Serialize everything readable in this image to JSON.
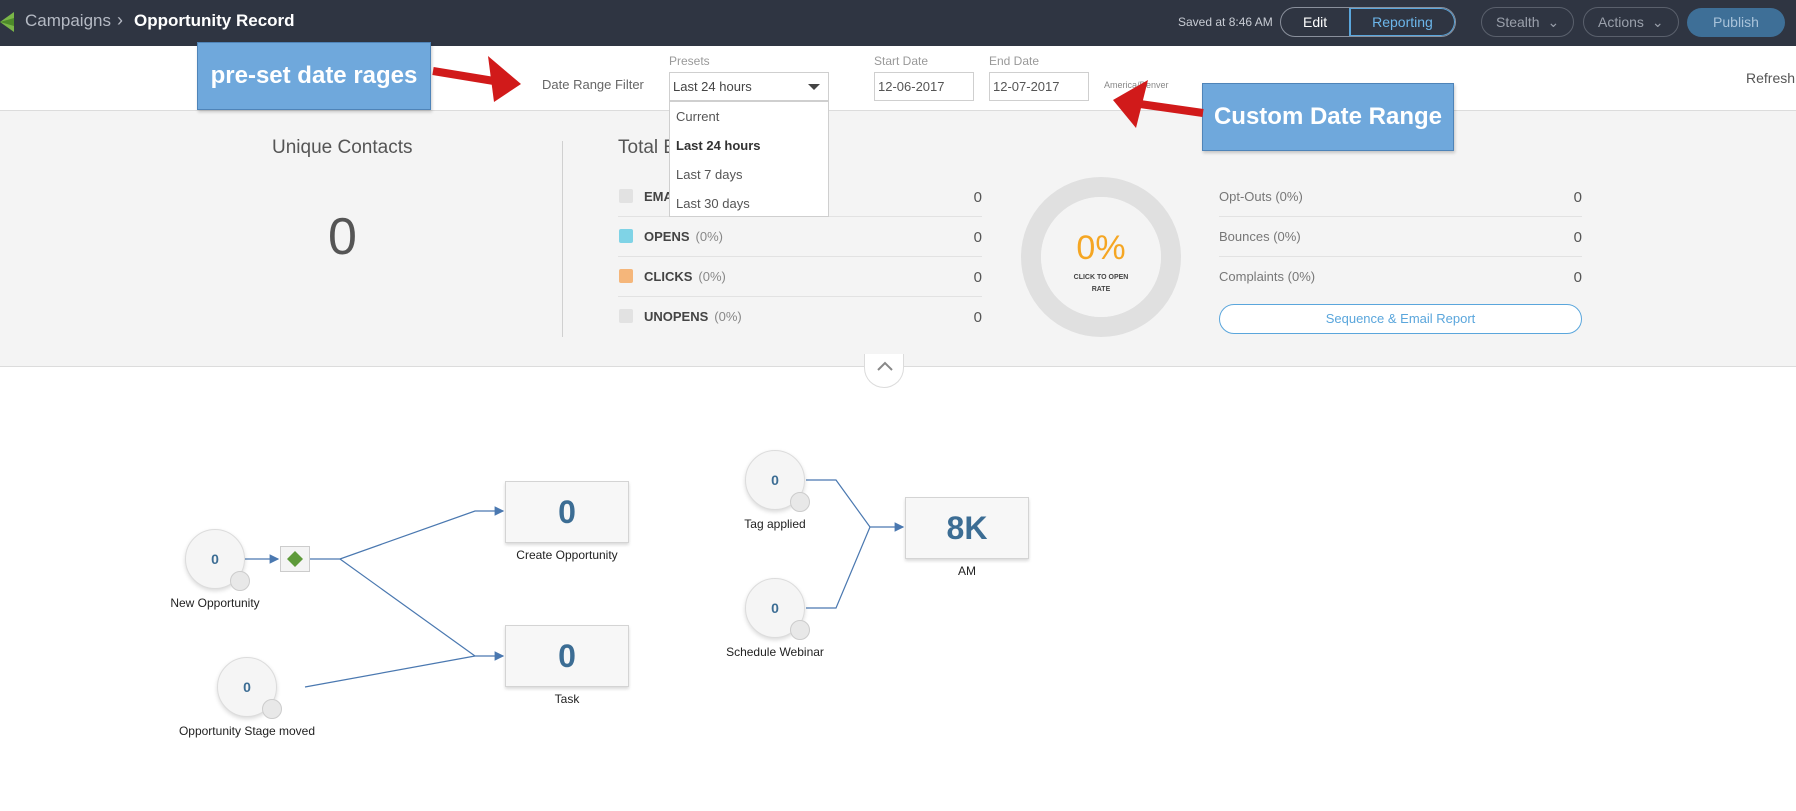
{
  "header": {
    "breadcrumb_root": "Campaigns",
    "breadcrumb_sep": "›",
    "title": "Opportunity Record",
    "saved_text": "Saved at 8:46 AM",
    "edit_label": "Edit",
    "reporting_label": "Reporting",
    "stealth_label": "Stealth",
    "actions_label": "Actions",
    "publish_label": "Publish"
  },
  "filter": {
    "label": "Date Range Filter",
    "presets_label": "Presets",
    "preset_value": "Last 24 hours",
    "start_label": "Start Date",
    "start_value": "12-06-2017",
    "end_label": "End Date",
    "end_value": "12-07-2017",
    "timezone": "America/Denver",
    "refresh_label": "Refresh",
    "options": [
      "Current",
      "Last 24 hours",
      "Last 7 days",
      "Last 30 days"
    ],
    "selected_option": "Last 24 hours"
  },
  "stats": {
    "unique_contacts_title": "Unique Contacts",
    "unique_contacts_value": "0",
    "total_title": "Total E",
    "metrics": [
      {
        "name": "EMA",
        "pct": "",
        "value": "0",
        "color": "#e2e2e2"
      },
      {
        "name": "OPENS",
        "pct": "(0%)",
        "value": "0",
        "color": "#7fd3e6"
      },
      {
        "name": "CLICKS",
        "pct": "(0%)",
        "value": "0",
        "color": "#f5b67a"
      },
      {
        "name": "UNOPENS",
        "pct": "(0%)",
        "value": "0",
        "color": "#e2e2e2"
      }
    ],
    "ring_value": "0%",
    "ring_caption": "CLICK TO OPEN RATE",
    "right_metrics": [
      {
        "name": "Opt-Outs (0%)",
        "value": "0"
      },
      {
        "name": "Bounces (0%)",
        "value": "0"
      },
      {
        "name": "Complaints (0%)",
        "value": "0"
      }
    ],
    "report_button": "Sequence & Email Report"
  },
  "flow": {
    "new_opportunity": {
      "count": "0",
      "label": "New Opportunity"
    },
    "stage_moved": {
      "count": "0",
      "label": "Opportunity Stage moved"
    },
    "create_opportunity": {
      "count": "0",
      "label": "Create Opportunity"
    },
    "task": {
      "count": "0",
      "label": "Task"
    },
    "tag_applied": {
      "count": "0",
      "label": "Tag applied"
    },
    "schedule_webinar": {
      "count": "0",
      "label": "Schedule Webinar"
    },
    "am": {
      "count": "8K",
      "label": "AM"
    }
  },
  "annotations": {
    "presets_callout": "pre-set date rages",
    "custom_callout": "Custom Date Range"
  },
  "colors": {
    "topbar": "#2f3542",
    "accent": "#5aa6dc",
    "ring_text": "#f5a623",
    "callout": "#6fa8dc",
    "arrow": "#d11a1a"
  }
}
